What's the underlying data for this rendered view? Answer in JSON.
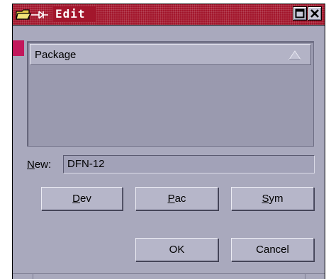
{
  "window": {
    "title": "Edit",
    "icons": {
      "app": "folder-pin-icon",
      "maximize": "maximize-icon",
      "close": "close-icon"
    }
  },
  "list": {
    "column_header": "Package",
    "sort_icon": "sort-ascending-icon",
    "rows": []
  },
  "new_field": {
    "label_mnemonic": "N",
    "label_rest": "ew:",
    "value": "DFN-12"
  },
  "buttons": {
    "dev": {
      "mnemonic": "D",
      "rest": "ev"
    },
    "pac": {
      "mnemonic": "P",
      "rest": "ac"
    },
    "sym": {
      "mnemonic": "S",
      "rest": "ym"
    },
    "ok": "OK",
    "cancel": "Cancel"
  },
  "colors": {
    "titlebar": "#a3162c",
    "window_bg": "#a9a9bd",
    "list_bg": "#9a9aaf",
    "button_face": "#b6b6c9",
    "accent_strip": "#c2185b"
  }
}
